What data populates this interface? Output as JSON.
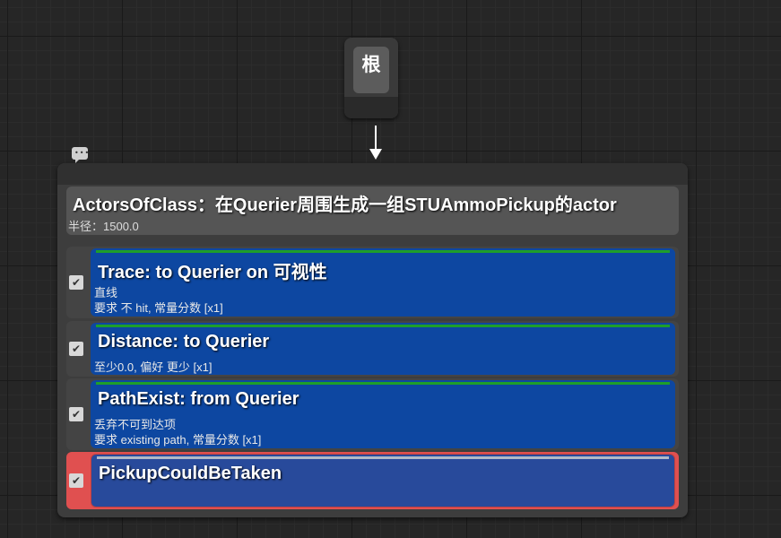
{
  "root": {
    "label": "根"
  },
  "query": {
    "generator": {
      "title": "ActorsOfClass：在Querier周围生成一组STUAmmoPickup的actor",
      "subtitle": "半径：1500.0"
    },
    "tests": [
      {
        "title": "Trace: to Querier on 可视性",
        "lines": [
          "直线",
          "要求 不 hit, 常量分数 [x1]"
        ],
        "checked": "✔"
      },
      {
        "title": "Distance: to Querier",
        "lines": [
          "至少0.0, 偏好 更少 [x1]"
        ],
        "checked": "✔"
      },
      {
        "title": "PathExist: from Querier",
        "lines": [
          "丢弃不可到达项",
          "要求 existing path, 常量分数 [x1]"
        ],
        "checked": "✔"
      },
      {
        "title": "PickupCouldBeTaken",
        "lines": [],
        "checked": "✔"
      }
    ]
  },
  "colors": {
    "test_card": "#0d47a1",
    "selected_border": "#e05050",
    "status_bar": "#1e9e2a"
  }
}
